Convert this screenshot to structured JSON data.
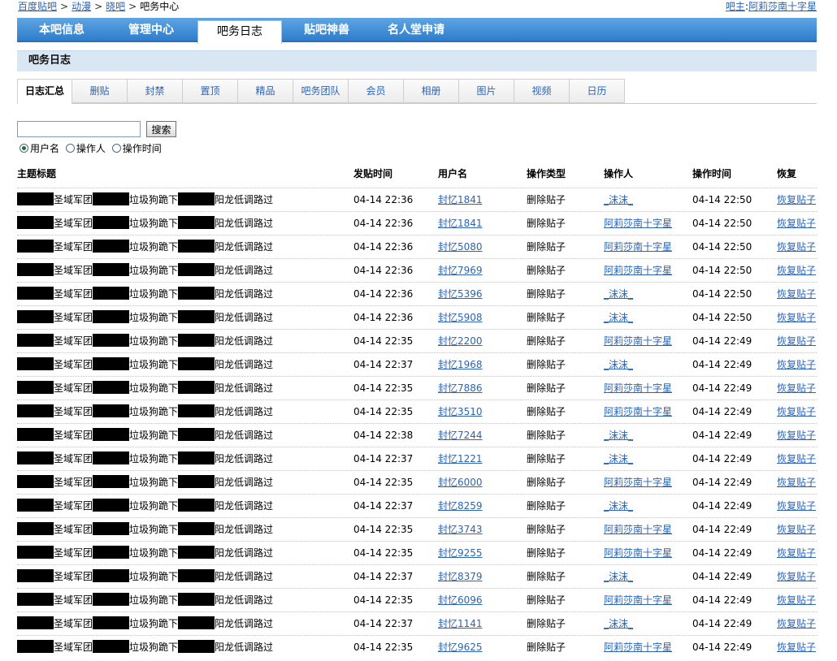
{
  "breadcrumb": {
    "items": [
      "百度贴吧",
      "动漫",
      "晓吧"
    ],
    "current": "吧务中心",
    "separator": ">"
  },
  "owner": {
    "label": "吧主",
    "colon": ":",
    "name": "阿莉莎南十字星"
  },
  "main_nav": {
    "tabs": [
      "本吧信息",
      "管理中心",
      "吧务日志",
      "贴吧神兽",
      "名人堂申请"
    ],
    "active_index": 2
  },
  "section_title": "吧务日志",
  "sub_tabs": {
    "tabs": [
      "日志汇总",
      "删贴",
      "封禁",
      "置顶",
      "精品",
      "吧务团队",
      "会员",
      "相册",
      "图片",
      "视频",
      "日历"
    ],
    "active_index": 0
  },
  "search": {
    "value": "",
    "button_label": "搜索"
  },
  "search_options": {
    "options": [
      "用户名",
      "操作人",
      "操作时间"
    ],
    "selected_index": 0
  },
  "table": {
    "headers": {
      "title": "主题标题",
      "post_time": "发贴时间",
      "username": "用户名",
      "op_type": "操作类型",
      "operator": "操作人",
      "op_time": "操作时间",
      "restore": "恢复"
    },
    "rows": [
      {
        "title_parts": [
          "圣域军团",
          "垃圾狗跪下",
          "阳龙低调路过"
        ],
        "post_time": "04-14 22:36",
        "username": "封忆1841",
        "op_type": "删除贴子",
        "operator": "_沫沫_",
        "op_time": "04-14 22:50",
        "restore": "恢复贴子"
      },
      {
        "title_parts": [
          "圣域军团",
          "垃圾狗跪下",
          "阳龙低调路过"
        ],
        "post_time": "04-14 22:36",
        "username": "封忆1841",
        "op_type": "删除贴子",
        "operator": "阿莉莎南十字星",
        "op_time": "04-14 22:50",
        "restore": "恢复贴子"
      },
      {
        "title_parts": [
          "圣域军团",
          "垃圾狗跪下",
          "阳龙低调路过"
        ],
        "post_time": "04-14 22:36",
        "username": "封忆5080",
        "op_type": "删除贴子",
        "operator": "阿莉莎南十字星",
        "op_time": "04-14 22:50",
        "restore": "恢复贴子"
      },
      {
        "title_parts": [
          "圣域军团",
          "垃圾狗跪下",
          "阳龙低调路过"
        ],
        "post_time": "04-14 22:36",
        "username": "封忆7969",
        "op_type": "删除贴子",
        "operator": "阿莉莎南十字星",
        "op_time": "04-14 22:50",
        "restore": "恢复贴子"
      },
      {
        "title_parts": [
          "圣域军团",
          "垃圾狗跪下",
          "阳龙低调路过"
        ],
        "post_time": "04-14 22:36",
        "username": "封忆5396",
        "op_type": "删除贴子",
        "operator": "_沫沫_",
        "op_time": "04-14 22:50",
        "restore": "恢复贴子"
      },
      {
        "title_parts": [
          "圣域军团",
          "垃圾狗跪下",
          "阳龙低调路过"
        ],
        "post_time": "04-14 22:36",
        "username": "封忆5908",
        "op_type": "删除贴子",
        "operator": "_沫沫_",
        "op_time": "04-14 22:50",
        "restore": "恢复贴子"
      },
      {
        "title_parts": [
          "圣域军团",
          "垃圾狗跪下",
          "阳龙低调路过"
        ],
        "post_time": "04-14 22:35",
        "username": "封忆2200",
        "op_type": "删除贴子",
        "operator": "阿莉莎南十字星",
        "op_time": "04-14 22:49",
        "restore": "恢复贴子"
      },
      {
        "title_parts": [
          "圣域军团",
          "垃圾狗跪下",
          "阳龙低调路过"
        ],
        "post_time": "04-14 22:37",
        "username": "封忆1968",
        "op_type": "删除贴子",
        "operator": "_沫沫_",
        "op_time": "04-14 22:49",
        "restore": "恢复贴子"
      },
      {
        "title_parts": [
          "圣域军团",
          "垃圾狗跪下",
          "阳龙低调路过"
        ],
        "post_time": "04-14 22:35",
        "username": "封忆7886",
        "op_type": "删除贴子",
        "operator": "阿莉莎南十字星",
        "op_time": "04-14 22:49",
        "restore": "恢复贴子"
      },
      {
        "title_parts": [
          "圣域军团",
          "垃圾狗跪下",
          "阳龙低调路过"
        ],
        "post_time": "04-14 22:35",
        "username": "封忆3510",
        "op_type": "删除贴子",
        "operator": "阿莉莎南十字星",
        "op_time": "04-14 22:49",
        "restore": "恢复贴子"
      },
      {
        "title_parts": [
          "圣域军团",
          "垃圾狗跪下",
          "阳龙低调路过"
        ],
        "post_time": "04-14 22:38",
        "username": "封忆7244",
        "op_type": "删除贴子",
        "operator": "_沫沫_",
        "op_time": "04-14 22:49",
        "restore": "恢复贴子"
      },
      {
        "title_parts": [
          "圣域军团",
          "垃圾狗跪下",
          "阳龙低调路过"
        ],
        "post_time": "04-14 22:37",
        "username": "封忆1221",
        "op_type": "删除贴子",
        "operator": "_沫沫_",
        "op_time": "04-14 22:49",
        "restore": "恢复贴子"
      },
      {
        "title_parts": [
          "圣域军团",
          "垃圾狗跪下",
          "阳龙低调路过"
        ],
        "post_time": "04-14 22:35",
        "username": "封忆6000",
        "op_type": "删除贴子",
        "operator": "阿莉莎南十字星",
        "op_time": "04-14 22:49",
        "restore": "恢复贴子"
      },
      {
        "title_parts": [
          "圣域军团",
          "垃圾狗跪下",
          "阳龙低调路过"
        ],
        "post_time": "04-14 22:37",
        "username": "封忆8259",
        "op_type": "删除贴子",
        "operator": "_沫沫_",
        "op_time": "04-14 22:49",
        "restore": "恢复贴子"
      },
      {
        "title_parts": [
          "圣域军团",
          "垃圾狗跪下",
          "阳龙低调路过"
        ],
        "post_time": "04-14 22:35",
        "username": "封忆3743",
        "op_type": "删除贴子",
        "operator": "阿莉莎南十字星",
        "op_time": "04-14 22:49",
        "restore": "恢复贴子"
      },
      {
        "title_parts": [
          "圣域军团",
          "垃圾狗跪下",
          "阳龙低调路过"
        ],
        "post_time": "04-14 22:35",
        "username": "封忆9255",
        "op_type": "删除贴子",
        "operator": "阿莉莎南十字星",
        "op_time": "04-14 22:49",
        "restore": "恢复贴子"
      },
      {
        "title_parts": [
          "圣域军团",
          "垃圾狗跪下",
          "阳龙低调路过"
        ],
        "post_time": "04-14 22:37",
        "username": "封忆8379",
        "op_type": "删除贴子",
        "operator": "_沫沫_",
        "op_time": "04-14 22:49",
        "restore": "恢复贴子"
      },
      {
        "title_parts": [
          "圣域军团",
          "垃圾狗跪下",
          "阳龙低调路过"
        ],
        "post_time": "04-14 22:35",
        "username": "封忆6096",
        "op_type": "删除贴子",
        "operator": "阿莉莎南十字星",
        "op_time": "04-14 22:49",
        "restore": "恢复贴子"
      },
      {
        "title_parts": [
          "圣域军团",
          "垃圾狗跪下",
          "阳龙低调路过"
        ],
        "post_time": "04-14 22:37",
        "username": "封忆1141",
        "op_type": "删除贴子",
        "operator": "_沫沫_",
        "op_time": "04-14 22:49",
        "restore": "恢复贴子"
      },
      {
        "title_parts": [
          "圣域军团",
          "垃圾狗跪下",
          "阳龙低调路过"
        ],
        "post_time": "04-14 22:35",
        "username": "封忆9625",
        "op_type": "删除贴子",
        "operator": "阿莉莎南十字星",
        "op_time": "04-14 22:49",
        "restore": "恢复贴子"
      }
    ]
  },
  "colors": {
    "nav_blue": "#3b8ad6",
    "link": "#2d64b3",
    "section_bg": "#d9e7f5",
    "redaction": "#000000"
  }
}
